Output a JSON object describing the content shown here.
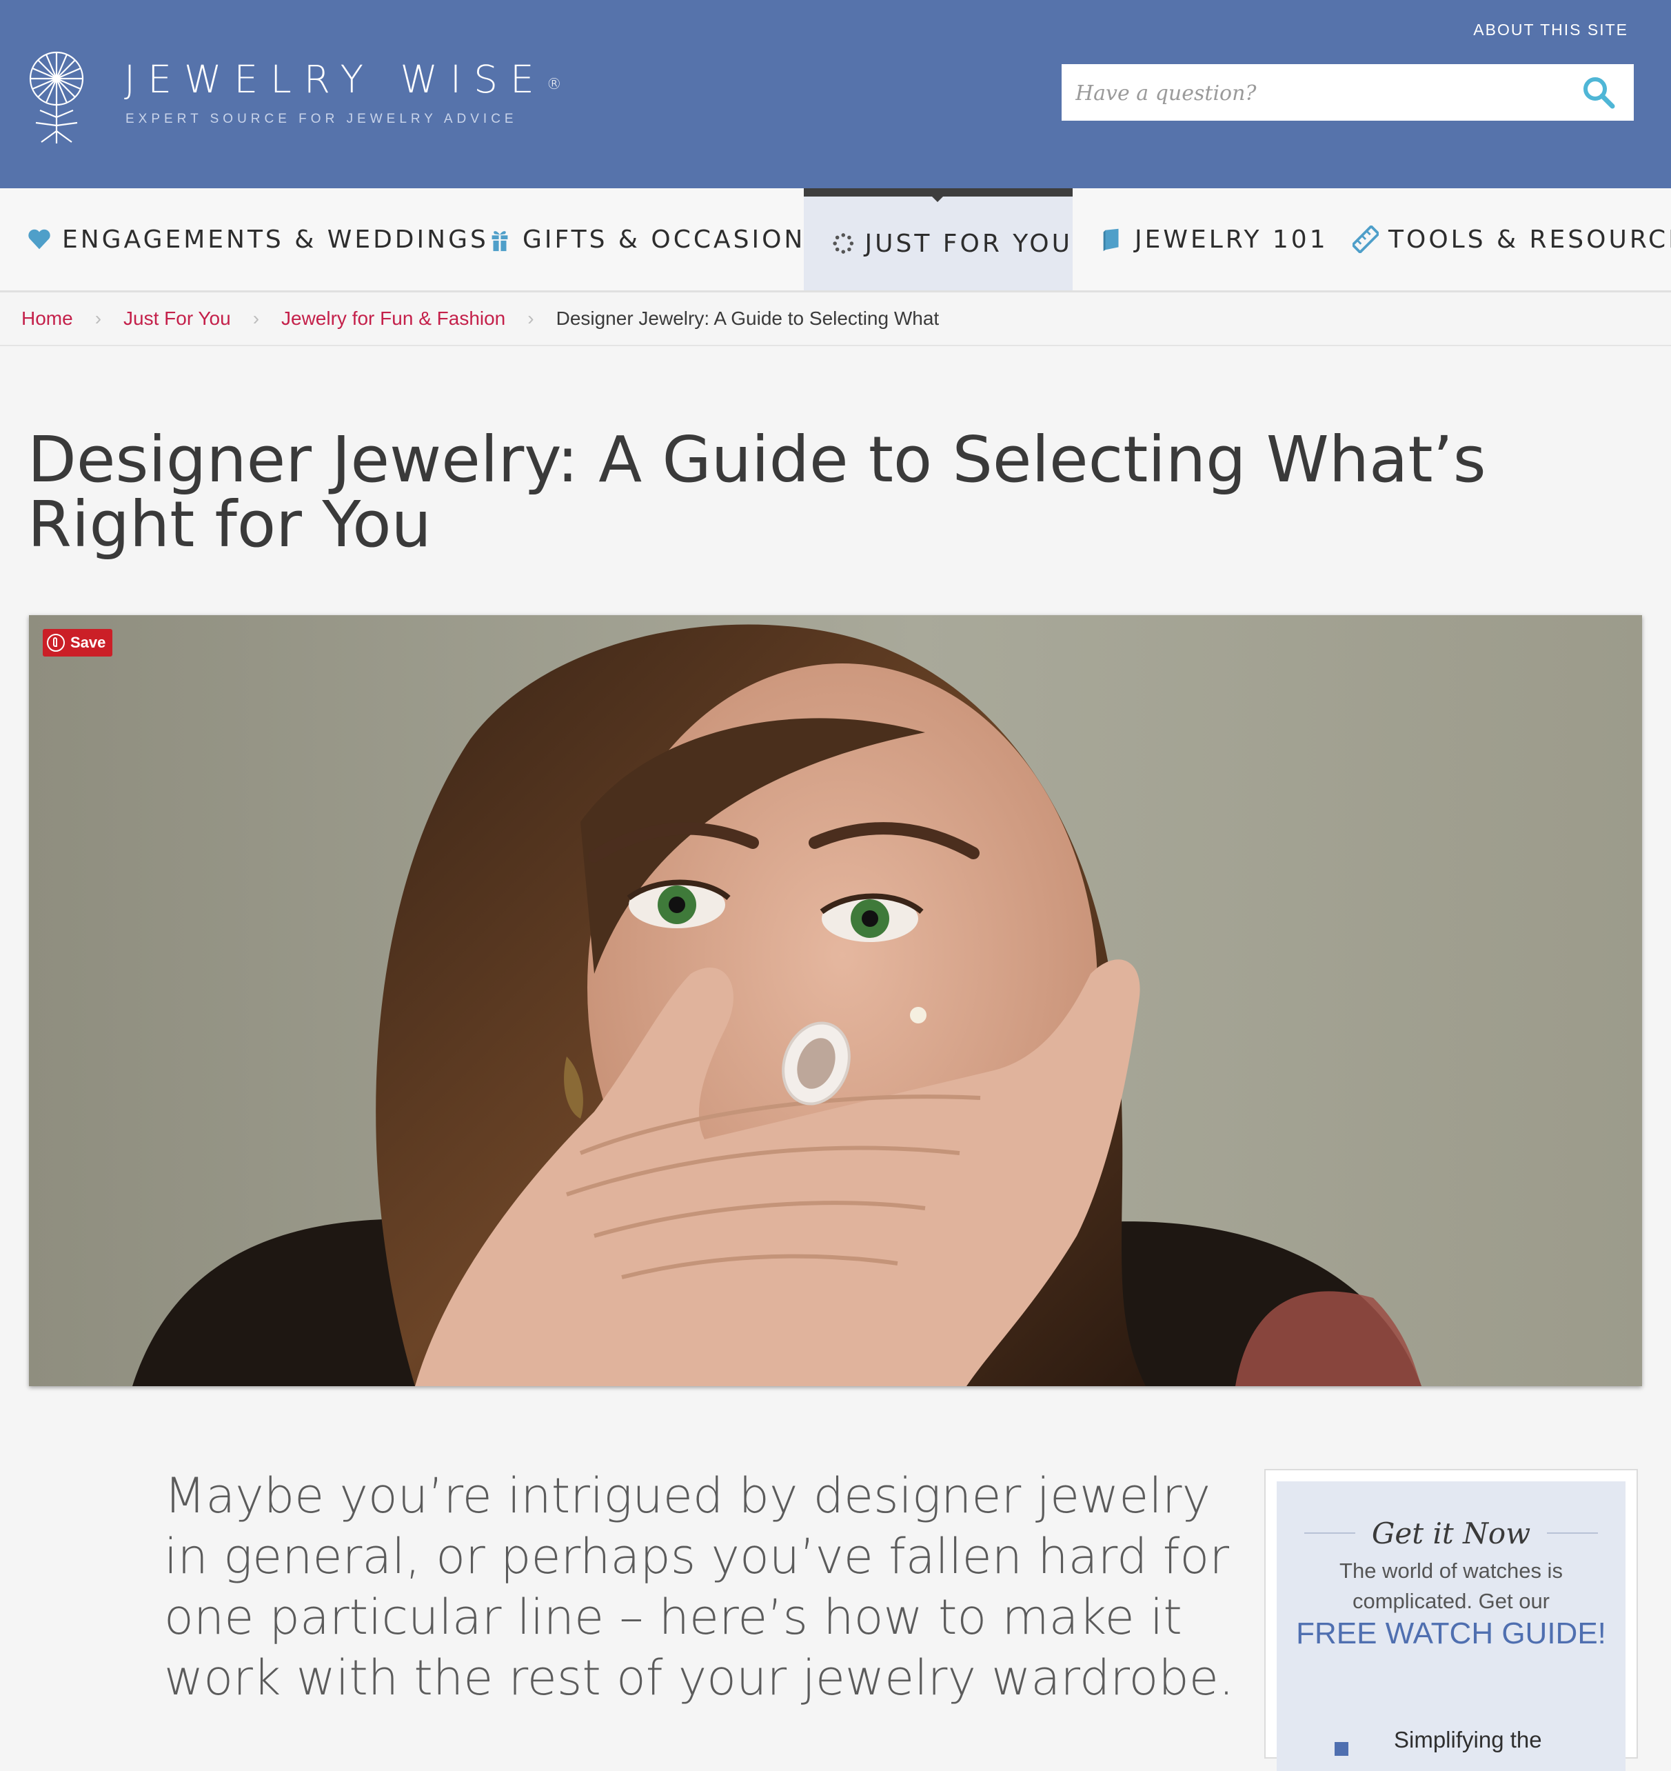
{
  "header": {
    "logo_text": "JEWELRY WISE",
    "logo_reg": "®",
    "tagline": "EXPERT SOURCE FOR JEWELRY ADVICE",
    "about_link": "ABOUT THIS SITE",
    "search_placeholder": "Have a question?",
    "colors": {
      "header_bg": "#5673ab",
      "search_icon": "#4fb6d6"
    }
  },
  "nav": {
    "items": [
      {
        "label": "ENGAGEMENTS & WEDDINGS",
        "icon": "heart-icon"
      },
      {
        "label": "GIFTS & OCCASIONS",
        "icon": "gift-icon"
      },
      {
        "label": "JUST FOR YOU",
        "icon": "sparkle-ring-icon",
        "active": true
      },
      {
        "label": "JEWELRY 101",
        "icon": "book-icon"
      },
      {
        "label": "TOOLS & RESOURCES",
        "icon": "ruler-icon"
      }
    ],
    "icon_color": "#4f9fc9"
  },
  "breadcrumb": {
    "items": [
      "Home",
      "Just For You",
      "Jewelry for Fun & Fashion"
    ],
    "current": "Designer Jewelry: A Guide to Selecting What",
    "link_color": "#c4204a"
  },
  "article": {
    "title": "Designer Jewelry: A Guide to Selecting What’s Right for You",
    "pin_label": "Save",
    "intro": "Maybe you’re intrigued by designer jewelry in general, or perhaps you’ve fallen hard for one particular line – here’s how to make it work with the rest of your jewelry wardrobe."
  },
  "promo": {
    "heading": "Get it Now",
    "text": "The world of watches is complicated. Get our",
    "cta": "FREE WATCH GUIDE!",
    "bullet": "Simplifying the"
  }
}
